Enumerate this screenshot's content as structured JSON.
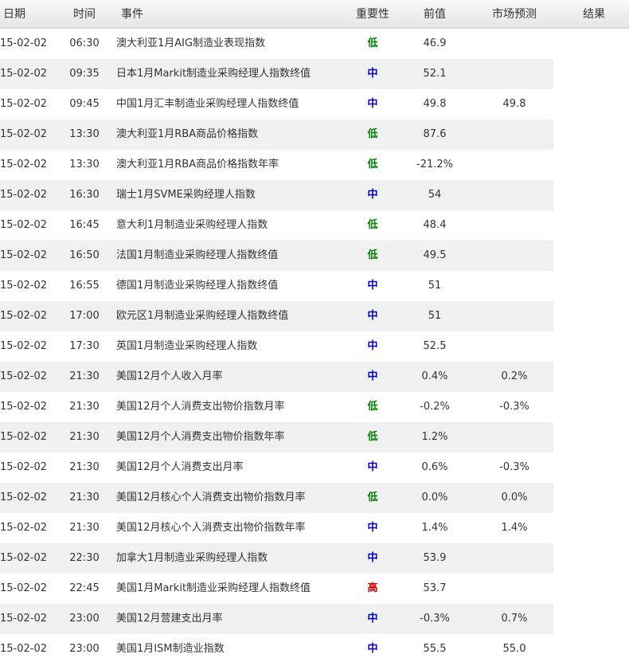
{
  "header": {
    "date": "日期",
    "time": "时间",
    "event": "事件",
    "importance": "重要性",
    "previous": "前值",
    "forecast": "市场预测",
    "result": "结果"
  },
  "importance_colors": {
    "低": "#008000",
    "中": "#0000cc",
    "高": "#cc0000"
  },
  "rows": [
    {
      "date": "15-02-02",
      "time": "06:30",
      "event": "澳大利亚1月AIG制造业表现指数",
      "importance": "低",
      "previous": "46.9",
      "forecast": "",
      "result": ""
    },
    {
      "date": "15-02-02",
      "time": "09:35",
      "event": "日本1月Markit制造业采购经理人指数终值",
      "importance": "中",
      "previous": "52.1",
      "forecast": "",
      "result": ""
    },
    {
      "date": "15-02-02",
      "time": "09:45",
      "event": "中国1月汇丰制造业采购经理人指数终值",
      "importance": "中",
      "previous": "49.8",
      "forecast": "49.8",
      "result": ""
    },
    {
      "date": "15-02-02",
      "time": "13:30",
      "event": "澳大利亚1月RBA商品价格指数",
      "importance": "低",
      "previous": "87.6",
      "forecast": "",
      "result": ""
    },
    {
      "date": "15-02-02",
      "time": "13:30",
      "event": "澳大利亚1月RBA商品价格指数年率",
      "importance": "低",
      "previous": "-21.2%",
      "forecast": "",
      "result": ""
    },
    {
      "date": "15-02-02",
      "time": "16:30",
      "event": "瑞士1月SVME采购经理人指数",
      "importance": "中",
      "previous": "54",
      "forecast": "",
      "result": ""
    },
    {
      "date": "15-02-02",
      "time": "16:45",
      "event": "意大利1月制造业采购经理人指数",
      "importance": "低",
      "previous": "48.4",
      "forecast": "",
      "result": ""
    },
    {
      "date": "15-02-02",
      "time": "16:50",
      "event": "法国1月制造业采购经理人指数终值",
      "importance": "低",
      "previous": "49.5",
      "forecast": "",
      "result": ""
    },
    {
      "date": "15-02-02",
      "time": "16:55",
      "event": "德国1月制造业采购经理人指数终值",
      "importance": "中",
      "previous": "51",
      "forecast": "",
      "result": ""
    },
    {
      "date": "15-02-02",
      "time": "17:00",
      "event": "欧元区1月制造业采购经理人指数终值",
      "importance": "中",
      "previous": "51",
      "forecast": "",
      "result": ""
    },
    {
      "date": "15-02-02",
      "time": "17:30",
      "event": "英国1月制造业采购经理人指数",
      "importance": "中",
      "previous": "52.5",
      "forecast": "",
      "result": ""
    },
    {
      "date": "15-02-02",
      "time": "21:30",
      "event": "美国12月个人收入月率",
      "importance": "中",
      "previous": "0.4%",
      "forecast": "0.2%",
      "result": ""
    },
    {
      "date": "15-02-02",
      "time": "21:30",
      "event": "美国12月个人消费支出物价指数月率",
      "importance": "低",
      "previous": "-0.2%",
      "forecast": "-0.3%",
      "result": ""
    },
    {
      "date": "15-02-02",
      "time": "21:30",
      "event": "美国12月个人消费支出物价指数年率",
      "importance": "低",
      "previous": "1.2%",
      "forecast": "",
      "result": ""
    },
    {
      "date": "15-02-02",
      "time": "21:30",
      "event": "美国12月个人消费支出月率",
      "importance": "中",
      "previous": "0.6%",
      "forecast": "-0.3%",
      "result": ""
    },
    {
      "date": "15-02-02",
      "time": "21:30",
      "event": "美国12月核心个人消费支出物价指数月率",
      "importance": "低",
      "previous": "0.0%",
      "forecast": "0.0%",
      "result": ""
    },
    {
      "date": "15-02-02",
      "time": "21:30",
      "event": "美国12月核心个人消费支出物价指数年率",
      "importance": "中",
      "previous": "1.4%",
      "forecast": "1.4%",
      "result": ""
    },
    {
      "date": "15-02-02",
      "time": "22:30",
      "event": "加拿大1月制造业采购经理人指数",
      "importance": "中",
      "previous": "53.9",
      "forecast": "",
      "result": ""
    },
    {
      "date": "15-02-02",
      "time": "22:45",
      "event": "美国1月Markit制造业采购经理人指数终值",
      "importance": "高",
      "previous": "53.7",
      "forecast": "",
      "result": ""
    },
    {
      "date": "15-02-02",
      "time": "23:00",
      "event": "美国12月营建支出月率",
      "importance": "中",
      "previous": "-0.3%",
      "forecast": "0.7%",
      "result": ""
    },
    {
      "date": "15-02-02",
      "time": "23:00",
      "event": "美国1月ISM制造业指数",
      "importance": "中",
      "previous": "55.5",
      "forecast": "55.0",
      "result": ""
    }
  ]
}
